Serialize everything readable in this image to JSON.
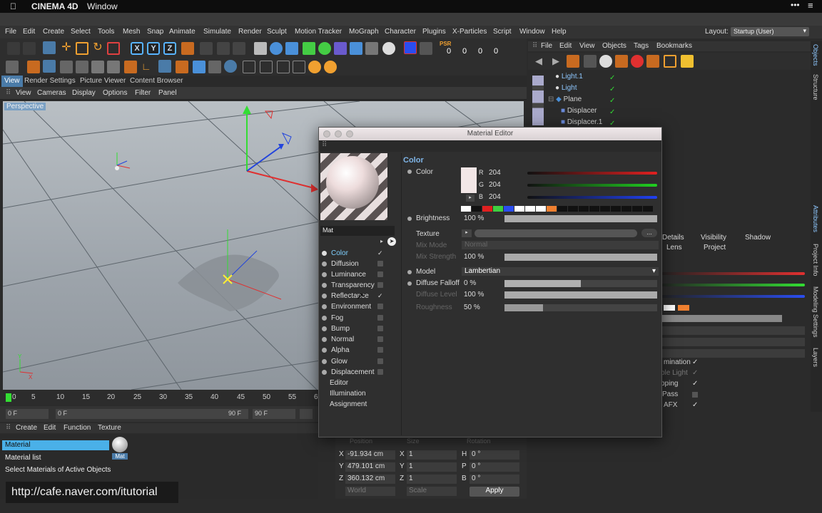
{
  "mac": {
    "app": "CINEMA 4D",
    "window": "Window",
    "apple": "",
    "dots": "•••",
    "menu": "≡"
  },
  "menubar": [
    "File",
    "Edit",
    "Create",
    "Select",
    "Tools",
    "Mesh",
    "Snap",
    "Animate",
    "Simulate",
    "Render",
    "Sculpt",
    "Motion Tracker",
    "MoGraph",
    "Character",
    "Plugins",
    "X-Particles",
    "Script",
    "Window",
    "Help"
  ],
  "layout": {
    "label": "Layout:",
    "value": "Startup (User)"
  },
  "toolbar": {
    "x": "X",
    "y": "Y",
    "z": "Z",
    "psr": "PSR",
    "counters": [
      "0",
      "0",
      "0",
      "0"
    ]
  },
  "viewtabs": [
    "View",
    "Render Settings",
    "Picture Viewer",
    "Content Browser"
  ],
  "viewmenu": [
    "View",
    "Cameras",
    "Display",
    "Options",
    "Filter",
    "Panel"
  ],
  "viewport": {
    "label": "Perspective"
  },
  "timeline": {
    "ticks": [
      "0",
      "5",
      "10",
      "15",
      "20",
      "25",
      "30",
      "35",
      "40",
      "45",
      "50",
      "55",
      "6"
    ],
    "start": "0 F",
    "cur": "0 F",
    "end": "90 F",
    "end2": "90 F"
  },
  "matmenu": [
    "Create",
    "Edit",
    "Function",
    "Texture"
  ],
  "matlist": [
    "Material",
    "Material list",
    "Select Materials of Active Objects"
  ],
  "mat_thumb": "Mat",
  "url": "http://cafe.naver.com/itutorial",
  "coords": {
    "headers": [
      "Position",
      "Size",
      "Rotation"
    ],
    "rows": [
      {
        "a": "X",
        "v1": "-91.934 cm",
        "b": "X",
        "v2": "1",
        "c": "H",
        "v3": "0 °"
      },
      {
        "a": "Y",
        "v1": "479.101 cm",
        "b": "Y",
        "v2": "1",
        "c": "P",
        "v3": "0 °"
      },
      {
        "a": "Z",
        "v1": "360.132 cm",
        "b": "Z",
        "v2": "1",
        "c": "B",
        "v3": "0 °"
      }
    ],
    "world": "World",
    "scale": "Scale",
    "apply": "Apply"
  },
  "objmenu": [
    "File",
    "Edit",
    "View",
    "Objects",
    "Tags",
    "Bookmarks"
  ],
  "objects": [
    {
      "name": "Light.1",
      "color": "#8fc8ff"
    },
    {
      "name": "Light",
      "color": "#8fc8ff"
    },
    {
      "name": "Plane",
      "color": "#bbbbbb"
    },
    {
      "name": "Displacer",
      "color": "#bbbbbb"
    },
    {
      "name": "Displacer.1",
      "color": "#bbbbbb"
    }
  ],
  "righttabs": [
    "Objects",
    "Structure",
    "Attributes",
    "Project Info",
    "Modeling Settings",
    "Layers"
  ],
  "attr_partial": {
    "tabs1": [
      "Details",
      "Visibility",
      "Shadow"
    ],
    "tabs2": [
      "Lens",
      "Project"
    ],
    "items": [
      {
        "t": "mination",
        "c": "✓"
      },
      {
        "t": "ble Light",
        "c": "✓"
      },
      {
        "t": "pping",
        "c": "✓"
      },
      {
        "t": "Pass",
        "c": ""
      },
      {
        "t": "AFX",
        "c": "✓"
      }
    ]
  },
  "me": {
    "title": "Material Editor",
    "name": "Mat",
    "channels": [
      {
        "label": "Color",
        "check": "✓",
        "active": true
      },
      {
        "label": "Diffusion",
        "check": ""
      },
      {
        "label": "Luminance",
        "check": ""
      },
      {
        "label": "Transparency",
        "check": ""
      },
      {
        "label": "Reflectance",
        "check": "✓"
      },
      {
        "label": "Environment",
        "check": ""
      },
      {
        "label": "Fog",
        "check": ""
      },
      {
        "label": "Bump",
        "check": ""
      },
      {
        "label": "Normal",
        "check": ""
      },
      {
        "label": "Alpha",
        "check": ""
      },
      {
        "label": "Glow",
        "check": ""
      },
      {
        "label": "Displacement",
        "check": ""
      }
    ],
    "extras": [
      "Editor",
      "Illumination",
      "Assignment"
    ],
    "section": "Color",
    "color": {
      "label": "Color",
      "r_label": "R",
      "g_label": "G",
      "b_label": "B",
      "r": "204",
      "g": "204",
      "b": "204",
      "swatch": "#f2e6e6"
    },
    "swatches": [
      "#ffffff",
      "#111111",
      "#e02020",
      "#3ed040",
      "#2a4df0",
      "#ffffff",
      "#ffffff",
      "#ffffff",
      "#f08030",
      "#111111",
      "#111111",
      "#111111",
      "#111111",
      "#111111",
      "#111111",
      "#111111",
      "#111111",
      "#111111"
    ],
    "brightness": {
      "label": "Brightness",
      "value": "100 %",
      "fraction": 1.0
    },
    "texture": {
      "label": "Texture",
      "more": "..."
    },
    "mixmode": {
      "label": "Mix Mode",
      "value": "Normal"
    },
    "mixstrength": {
      "label": "Mix Strength",
      "value": "100 %",
      "fraction": 1.0
    },
    "model": {
      "label": "Model",
      "value": "Lambertian"
    },
    "falloff": {
      "label": "Diffuse Falloff",
      "value": "0 %",
      "fraction": 0.5
    },
    "level": {
      "label": "Diffuse Level",
      "value": "100 %",
      "fraction": 1.0
    },
    "roughness": {
      "label": "Roughness",
      "value": "50 %",
      "fraction": 0.25
    }
  }
}
